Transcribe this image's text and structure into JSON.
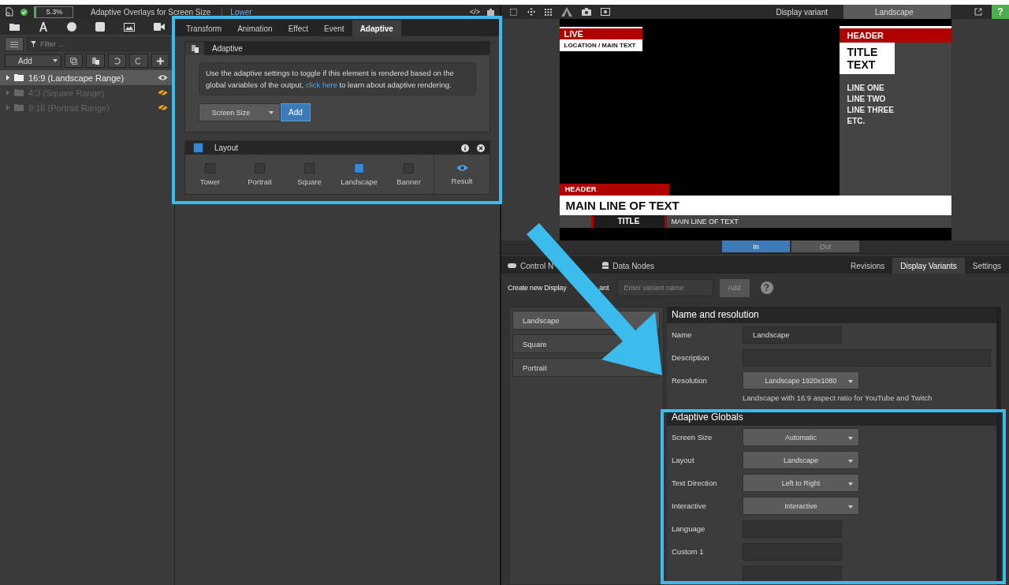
{
  "top_bar": {
    "zoom": "5.3%",
    "title": "Adaptive Overlays for Screen Size",
    "breadcrumb": "Lower",
    "code_toggle": "</>"
  },
  "tree": {
    "filter_placeholder": "Filter ...",
    "add_button": "Add",
    "items": [
      {
        "label": "16:9 (Landscape Range)",
        "selected": true,
        "visible": true
      },
      {
        "label": "4:3 (Square Range)",
        "selected": false,
        "visible": false
      },
      {
        "label": "9:16 (Portrait Range)",
        "selected": false,
        "visible": false
      }
    ]
  },
  "properties": {
    "tabs": [
      {
        "label": "Transform",
        "selected": false
      },
      {
        "label": "Animation",
        "selected": false
      },
      {
        "label": "Effect",
        "selected": false
      },
      {
        "label": "Event",
        "selected": false
      },
      {
        "label": "Adaptive",
        "selected": true
      }
    ],
    "adaptive_panel": {
      "title": "Adaptive",
      "info_before": "Use the adaptive settings to toggle if this element is rendered based on the global variables of the output, ",
      "info_link": "click here",
      "info_after": " to learn about adaptive rendering.",
      "select": "Screen Size",
      "add_button": "Add"
    },
    "layout_panel": {
      "title": "Layout",
      "enabled": true,
      "options": [
        {
          "label": "Tower",
          "checked": false
        },
        {
          "label": "Portrait",
          "checked": false
        },
        {
          "label": "Square",
          "checked": false
        },
        {
          "label": "Landscape",
          "checked": true
        },
        {
          "label": "Banner",
          "checked": false
        }
      ],
      "result": "Result"
    }
  },
  "preview_toolbar": {
    "display_variant_label": "Display variant",
    "display_variant": "Landscape",
    "help": "?"
  },
  "preview": {
    "live_bug": {
      "tag": "LIVE",
      "text": "LOCATION / MAIN TEXT"
    },
    "sidebar": {
      "header": "HEADER",
      "title": "TITLE TEXT",
      "lines": [
        "LINE ONE",
        "LINE TWO",
        "LINE THREE",
        "ETC."
      ]
    },
    "lower_third": {
      "header": "HEADER",
      "main": "MAIN LINE OF TEXT"
    },
    "ticker": {
      "title": "TITLE",
      "text": "MAIN LINE OF TEXT"
    }
  },
  "playback": [
    {
      "label": "In",
      "selected": true
    },
    {
      "label": "Out",
      "selected": false
    }
  ],
  "bottom_panel": {
    "tabs_left": [
      {
        "label": "Control N",
        "selected": false
      },
      {
        "label": "Data Nodes",
        "selected": false
      }
    ],
    "tabs_right": [
      {
        "label": "Revisions",
        "selected": false
      },
      {
        "label": "Display Variants",
        "selected": true
      },
      {
        "label": "Settings",
        "selected": false
      }
    ],
    "create": {
      "label": "Create new Display",
      "label_tail": "ant",
      "placeholder": "Enter variant name",
      "button": "Add",
      "disabled": true,
      "help": "?"
    },
    "variants": [
      {
        "label": "Landscape",
        "selected": true
      },
      {
        "label": "Square",
        "selected": false
      },
      {
        "label": "Portrait",
        "selected": false
      }
    ],
    "name_resolution": {
      "title": "Name and resolution",
      "fields": [
        {
          "kind": "input",
          "label": "Name",
          "value": "Landscape"
        },
        {
          "kind": "wide_input",
          "label": "Description"
        },
        {
          "kind": "select",
          "label": "Resolution",
          "value": "Landscape 1920x1080"
        }
      ],
      "hint": "Landscape with 16:9 aspect ratio for YouTube and Twitch"
    },
    "adaptive_globals": {
      "title": "Adaptive Globals",
      "fields": [
        {
          "kind": "select",
          "label": "Screen Size",
          "value": "Automatic"
        },
        {
          "kind": "select",
          "label": "Layout",
          "value": "Landscape"
        },
        {
          "kind": "select",
          "label": "Text Direction",
          "value": "Left to Right"
        },
        {
          "kind": "select",
          "label": "Interactive",
          "value": "Interactive"
        },
        {
          "kind": "input",
          "label": "Language"
        },
        {
          "kind": "input",
          "label": "Custom 1"
        },
        {
          "kind": "input"
        }
      ]
    }
  }
}
